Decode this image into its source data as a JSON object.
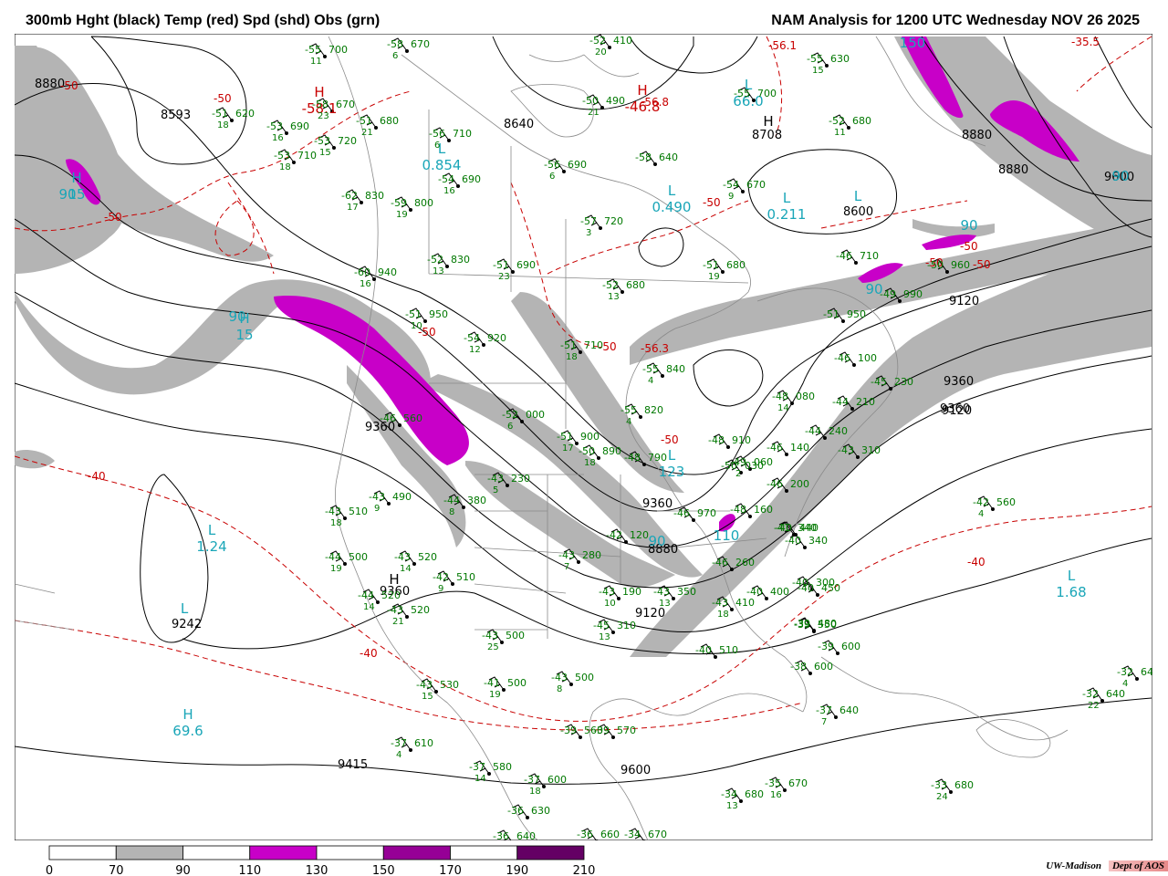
{
  "title_left": "300mb Hght (black) Temp (red) Spd (shd) Obs (grn)",
  "title_right": "NAM Analysis for 1200 UTC Wednesday  NOV 26 2025",
  "credit": {
    "institution": "UW-Madison",
    "dept": "Dept of AOS"
  },
  "legend": {
    "ticks": [
      "0",
      "70",
      "90",
      "110",
      "130",
      "150",
      "170",
      "190",
      "210"
    ],
    "colors": [
      "#ffffff",
      "#b4b4b4",
      "#ffffff",
      "#c800c8",
      "#ffffff",
      "#960096",
      "#ffffff",
      "#640064"
    ]
  },
  "colors": {
    "height": "#000000",
    "temp": "#c80000",
    "speed_jet": "#c800c8",
    "speed_shade": "#b4b4b4",
    "obs": "#007800",
    "center_label": "#1aa6b8"
  },
  "height_labels": [
    "8880",
    "8593",
    "8640",
    "8708",
    "8600",
    "8880",
    "8880",
    "9120",
    "9360",
    "9120",
    "9360",
    "9360",
    "9360",
    "8880",
    "9120",
    "9360",
    "9242",
    "9415",
    "9600",
    "9600"
  ],
  "temp_labels": [
    "-50",
    "-50",
    "-50",
    "-56.1",
    "-35.5",
    "-50",
    "-50",
    "-50",
    "-50",
    "-56.8",
    "-50",
    "-56.3",
    "-50",
    "-50",
    "-40",
    "-40",
    "-40"
  ],
  "centers": [
    {
      "type": "H",
      "value": "15"
    },
    {
      "type": "H",
      "value": "-58.1"
    },
    {
      "type": "L",
      "value": "0.854"
    },
    {
      "type": "H",
      "value": "-46.8"
    },
    {
      "type": "L",
      "value": "66.0"
    },
    {
      "type": "H",
      "value": ""
    },
    {
      "type": "L",
      "value": "0.490"
    },
    {
      "type": "L",
      "value": "0.211"
    },
    {
      "type": "L",
      "value": ""
    },
    {
      "type": "H",
      "value": "15"
    },
    {
      "type": "L",
      "value": "1.24"
    },
    {
      "type": "L",
      "value": "123"
    },
    {
      "type": "H",
      "value": ""
    },
    {
      "type": "L",
      "value": ""
    },
    {
      "type": "H",
      "value": "69.6"
    },
    {
      "type": "L",
      "value": "1.68"
    }
  ],
  "speed_labels": [
    "90",
    "90",
    "90",
    "90",
    "150",
    "90",
    "90",
    "110"
  ],
  "obs": [
    {
      "t": "-55",
      "h": "700",
      "d": "11"
    },
    {
      "t": "-58",
      "h": "670",
      "d": "6"
    },
    {
      "t": "-52",
      "h": "410",
      "d": "20"
    },
    {
      "t": "-51",
      "h": "620",
      "d": "18"
    },
    {
      "t": "-53",
      "h": "690",
      "d": "16"
    },
    {
      "t": "-53",
      "h": "720",
      "d": "15"
    },
    {
      "t": "-53",
      "h": "710",
      "d": "18"
    },
    {
      "t": "-51",
      "h": "680",
      "d": "21"
    },
    {
      "t": "-58",
      "h": "670",
      "d": "23"
    },
    {
      "t": "-56",
      "h": "710",
      "d": "6"
    },
    {
      "t": "-50",
      "h": "490",
      "d": "21"
    },
    {
      "t": "-56",
      "h": "690",
      "d": "6"
    },
    {
      "t": "-58",
      "h": "640",
      "d": ""
    },
    {
      "t": "-55",
      "h": "700",
      "d": ""
    },
    {
      "t": "-55",
      "h": "630",
      "d": "15"
    },
    {
      "t": "-52",
      "h": "680",
      "d": "11"
    },
    {
      "t": "-54",
      "h": "690",
      "d": "16"
    },
    {
      "t": "-54",
      "h": "670",
      "d": "9"
    },
    {
      "t": "-57",
      "h": "720",
      "d": "3"
    },
    {
      "t": "-62",
      "h": "830",
      "d": "17"
    },
    {
      "t": "-59",
      "h": "800",
      "d": "19"
    },
    {
      "t": "-52",
      "h": "830",
      "d": "13"
    },
    {
      "t": "-51",
      "h": "690",
      "d": "23"
    },
    {
      "t": "-52",
      "h": "680",
      "d": "13"
    },
    {
      "t": "-51",
      "h": "680",
      "d": "19"
    },
    {
      "t": "-46",
      "h": "710",
      "d": ""
    },
    {
      "t": "-60",
      "h": "940",
      "d": "16"
    },
    {
      "t": "-51",
      "h": "950",
      "d": "10"
    },
    {
      "t": "-54",
      "h": "920",
      "d": "12"
    },
    {
      "t": "-51",
      "h": "710",
      "d": "18"
    },
    {
      "t": "-55",
      "h": "840",
      "d": "4"
    },
    {
      "t": "-49",
      "h": "990",
      "d": ""
    },
    {
      "t": "-50",
      "h": "960",
      "d": ""
    },
    {
      "t": "-51",
      "h": "950",
      "d": ""
    },
    {
      "t": "-46",
      "h": "100",
      "d": ""
    },
    {
      "t": "-45",
      "h": "230",
      "d": ""
    },
    {
      "t": "-44",
      "h": "210",
      "d": ""
    },
    {
      "t": "-48",
      "h": "080",
      "d": "14"
    },
    {
      "t": "-49",
      "h": "060",
      "d": "2"
    },
    {
      "t": "-46",
      "h": "560",
      "d": ""
    },
    {
      "t": "-52",
      "h": "000",
      "d": "6"
    },
    {
      "t": "-55",
      "h": "820",
      "d": "4"
    },
    {
      "t": "-51",
      "h": "900",
      "d": "17"
    },
    {
      "t": "-50",
      "h": "890",
      "d": "18"
    },
    {
      "t": "-48",
      "h": "790",
      "d": ""
    },
    {
      "t": "-48",
      "h": "910",
      "d": ""
    },
    {
      "t": "-50",
      "h": "030",
      "d": ""
    },
    {
      "t": "-44",
      "h": "240",
      "d": ""
    },
    {
      "t": "-43",
      "h": "310",
      "d": ""
    },
    {
      "t": "-46",
      "h": "140",
      "d": ""
    },
    {
      "t": "-46",
      "h": "200",
      "d": ""
    },
    {
      "t": "-41",
      "h": "340",
      "d": ""
    },
    {
      "t": "-43",
      "h": "230",
      "d": "5"
    },
    {
      "t": "-44",
      "h": "380",
      "d": "8"
    },
    {
      "t": "-43",
      "h": "490",
      "d": "9"
    },
    {
      "t": "-43",
      "h": "510",
      "d": "18"
    },
    {
      "t": "-44",
      "h": "500",
      "d": "19"
    },
    {
      "t": "-43",
      "h": "520",
      "d": "14"
    },
    {
      "t": "-42",
      "h": "510",
      "d": "9"
    },
    {
      "t": "-44",
      "h": "520",
      "d": "14"
    },
    {
      "t": "-43",
      "h": "520",
      "d": "21"
    },
    {
      "t": "-43",
      "h": "500",
      "d": "25"
    },
    {
      "t": "-43",
      "h": "530",
      "d": "15"
    },
    {
      "t": "-41",
      "h": "500",
      "d": "19"
    },
    {
      "t": "-43",
      "h": "500",
      "d": "8"
    },
    {
      "t": "-46",
      "h": "970",
      "d": ""
    },
    {
      "t": "-48",
      "h": "160",
      "d": ""
    },
    {
      "t": "-42",
      "h": "120",
      "d": ""
    },
    {
      "t": "-43",
      "h": "280",
      "d": "7"
    },
    {
      "t": "-46",
      "h": "260",
      "d": ""
    },
    {
      "t": "-43",
      "h": "190",
      "d": "10"
    },
    {
      "t": "-43",
      "h": "350",
      "d": "13"
    },
    {
      "t": "-45",
      "h": "310",
      "d": "13"
    },
    {
      "t": "-43",
      "h": "410",
      "d": "18"
    },
    {
      "t": "-40",
      "h": "440",
      "d": ""
    },
    {
      "t": "-40",
      "h": "340",
      "d": ""
    },
    {
      "t": "-40",
      "h": "400",
      "d": ""
    },
    {
      "t": "-40",
      "h": "450",
      "d": ""
    },
    {
      "t": "-39",
      "h": "480",
      "d": ""
    },
    {
      "t": "-40",
      "h": "510",
      "d": ""
    },
    {
      "t": "-40",
      "h": "300",
      "d": ""
    },
    {
      "t": "-39",
      "h": "550",
      "d": ""
    },
    {
      "t": "-39",
      "h": "600",
      "d": ""
    },
    {
      "t": "-38",
      "h": "600",
      "d": ""
    },
    {
      "t": "-37",
      "h": "640",
      "d": "7"
    },
    {
      "t": "-42",
      "h": "560",
      "d": "4"
    },
    {
      "t": "-32",
      "h": "640",
      "d": "4"
    },
    {
      "t": "-32",
      "h": "640",
      "d": "22"
    },
    {
      "t": "-39",
      "h": "560",
      "d": ""
    },
    {
      "t": "-39",
      "h": "570",
      "d": ""
    },
    {
      "t": "-37",
      "h": "610",
      "d": "4"
    },
    {
      "t": "-37",
      "h": "580",
      "d": "14"
    },
    {
      "t": "-37",
      "h": "600",
      "d": "18"
    },
    {
      "t": "-36",
      "h": "630",
      "d": ""
    },
    {
      "t": "-36",
      "h": "640",
      "d": ""
    },
    {
      "t": "-36",
      "h": "660",
      "d": ""
    },
    {
      "t": "-34",
      "h": "670",
      "d": ""
    },
    {
      "t": "-34",
      "h": "680",
      "d": "13"
    },
    {
      "t": "-35",
      "h": "670",
      "d": "16"
    },
    {
      "t": "-33",
      "h": "680",
      "d": "24"
    }
  ]
}
